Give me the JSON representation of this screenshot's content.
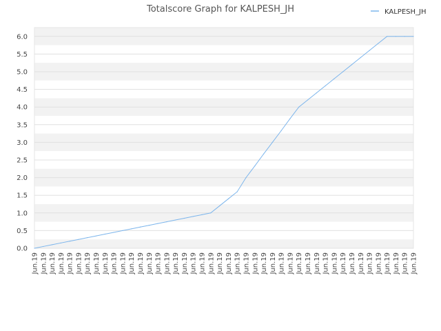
{
  "chart_data": {
    "type": "line",
    "title": "Totalscore Graph for KALPESH_JH",
    "xlabel": "",
    "ylabel": "",
    "ylim": [
      0,
      6.25
    ],
    "yticks": [
      "0.0",
      "0.5",
      "1.0",
      "1.5",
      "2.0",
      "2.5",
      "3.0",
      "3.5",
      "4.0",
      "4.5",
      "5.0",
      "5.5",
      "6.0"
    ],
    "x": [
      "Jun.19",
      "Jun.19",
      "Jun.19",
      "Jun.19",
      "Jun.19",
      "Jun.19",
      "Jun.19",
      "Jun.19",
      "Jun.19",
      "Jun.19",
      "Jun.19",
      "Jun.19",
      "Jun.19",
      "Jun.19",
      "Jun.19",
      "Jun.19",
      "Jun.19",
      "Jun.19",
      "Jun.19",
      "Jun.19",
      "Jun.19",
      "Jun.19",
      "Jun.19",
      "Jun.19",
      "Jun.19",
      "Jun.19",
      "Jun.19",
      "Jun.19",
      "Jun.19",
      "Jun.19",
      "Jun.19",
      "Jun.19",
      "Jun.19",
      "Jun.19",
      "Jun.19",
      "Jun.19",
      "Jun.19",
      "Jun.19",
      "Jun.19",
      "Jun.19",
      "Jun.19",
      "Jun.19",
      "Jun.19",
      "Jun.19"
    ],
    "series": [
      {
        "name": "KALPESH_JH",
        "color": "#7cb5ec",
        "values": [
          0,
          0.05,
          0.1,
          0.15,
          0.2,
          0.25,
          0.3,
          0.35,
          0.4,
          0.45,
          0.5,
          0.55,
          0.6,
          0.65,
          0.7,
          0.75,
          0.8,
          0.85,
          0.9,
          0.95,
          1.0,
          1.2,
          1.4,
          1.6,
          2.0,
          2.33,
          2.67,
          3.0,
          3.33,
          3.67,
          4.0,
          4.2,
          4.4,
          4.6,
          4.8,
          5.0,
          5.2,
          5.4,
          5.6,
          5.8,
          6.0,
          6.0,
          6.0,
          6.0
        ]
      }
    ],
    "grid": true,
    "legend_position": "top-right"
  }
}
